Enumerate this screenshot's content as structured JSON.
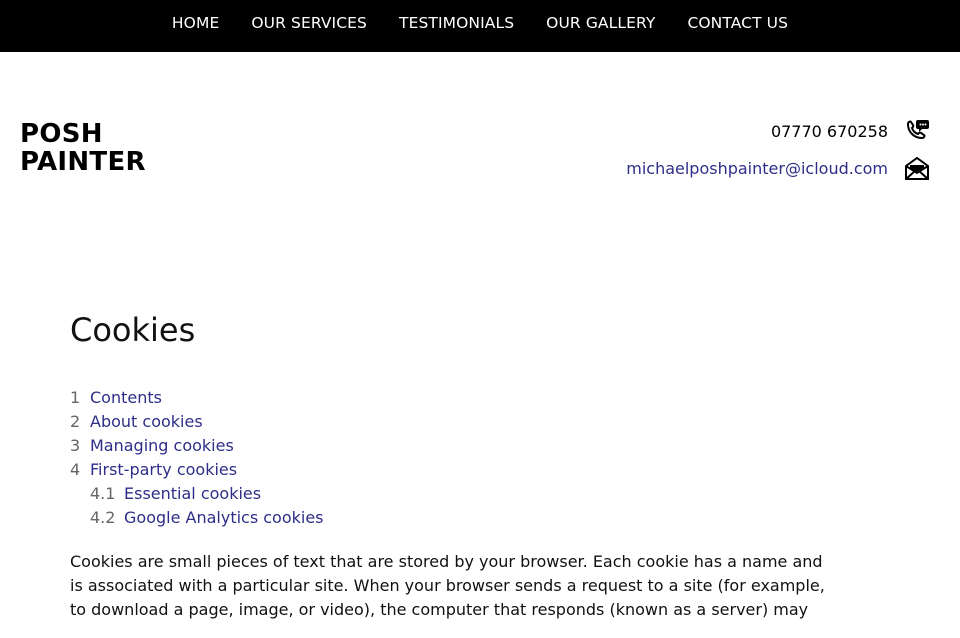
{
  "nav": {
    "items": [
      {
        "label": "HOME"
      },
      {
        "label": "OUR SERVICES"
      },
      {
        "label": "TESTIMONIALS"
      },
      {
        "label": "OUR GALLERY"
      },
      {
        "label": "CONTACT US"
      }
    ]
  },
  "brand": {
    "line1": "POSH",
    "line2": "PAINTER"
  },
  "contact": {
    "phone": "07770 670258",
    "phone_icon": "phone-chat-icon",
    "email": "michaelposhpainter@icloud.com",
    "email_icon": "envelope-icon"
  },
  "page": {
    "title": "Cookies",
    "toc": [
      {
        "num": "1",
        "label": "Contents"
      },
      {
        "num": "2",
        "label": "About cookies"
      },
      {
        "num": "3",
        "label": "Managing cookies"
      },
      {
        "num": "4",
        "label": "First-party cookies"
      },
      {
        "num": "4.1",
        "label": "Essential cookies"
      },
      {
        "num": "4.2",
        "label": "Google Analytics cookies"
      }
    ],
    "intro": "Cookies are small pieces of text that are stored by your browser. Each cookie has a name and is associated with a particular site. When your browser sends a request to a site (for example, to download a page, image, or video), the computer that responds (known as a server) may"
  },
  "colors": {
    "nav_bg": "#000000",
    "link": "#2e2e88"
  }
}
